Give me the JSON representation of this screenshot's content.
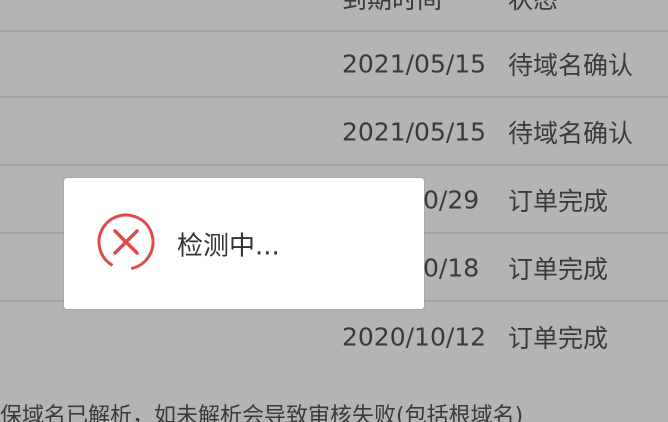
{
  "table": {
    "header": {
      "date": "到期时间",
      "status": "状态"
    },
    "rows": [
      {
        "date": "2021/05/15",
        "status": "待域名确认"
      },
      {
        "date": "2021/05/15",
        "status": "待域名确认"
      },
      {
        "date": "0/29",
        "status": "订单完成"
      },
      {
        "date": "0/18",
        "status": "订单完成"
      },
      {
        "date": "2020/10/12",
        "status": "订单完成"
      }
    ]
  },
  "footer_note": "保域名已解析，如未解析会导致审核失败(包括根域名)",
  "dialog": {
    "message": "检测中...",
    "icon": "error-circle-icon",
    "icon_color": "#e04a4a"
  },
  "colors": {
    "overlay_bg": "#b4b4b4",
    "dialog_bg": "#ffffff",
    "divider": "#a2a2a2"
  }
}
